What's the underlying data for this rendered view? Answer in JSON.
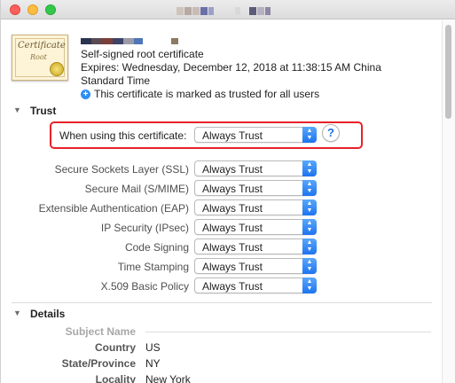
{
  "window": {
    "controls": [
      "close",
      "minimize",
      "zoom"
    ]
  },
  "certificate": {
    "icon_text": "Certificate",
    "icon_subtext": "Root",
    "type": "Self-signed root certificate",
    "expires_line1": "Expires: Wednesday, December 12, 2018 at 11:38:15 AM China",
    "expires_line2": "Standard Time",
    "trusted_note": "This certificate is marked as trusted for all users",
    "trusted_icon": "plus-circle-icon"
  },
  "trust": {
    "section_title": "Trust",
    "toggle_icon": "disclosure-triangle-down-icon",
    "main_label": "When using this certificate:",
    "main_value": "Always Trust",
    "help_label": "?",
    "rows": [
      {
        "label": "Secure Sockets Layer (SSL)",
        "value": "Always Trust"
      },
      {
        "label": "Secure Mail (S/MIME)",
        "value": "Always Trust"
      },
      {
        "label": "Extensible Authentication (EAP)",
        "value": "Always Trust"
      },
      {
        "label": "IP Security (IPsec)",
        "value": "Always Trust"
      },
      {
        "label": "Code Signing",
        "value": "Always Trust"
      },
      {
        "label": "Time Stamping",
        "value": "Always Trust"
      },
      {
        "label": "X.509 Basic Policy",
        "value": "Always Trust"
      }
    ]
  },
  "details": {
    "section_title": "Details",
    "toggle_icon": "disclosure-triangle-down-icon",
    "subject_name_label": "Subject Name",
    "fields": [
      {
        "label": "Country",
        "value": "US"
      },
      {
        "label": "State/Province",
        "value": "NY"
      },
      {
        "label": "Locality",
        "value": "New York"
      }
    ]
  },
  "colors": {
    "highlight_border": "#e8212a",
    "select_accent": "#1d74f0"
  }
}
